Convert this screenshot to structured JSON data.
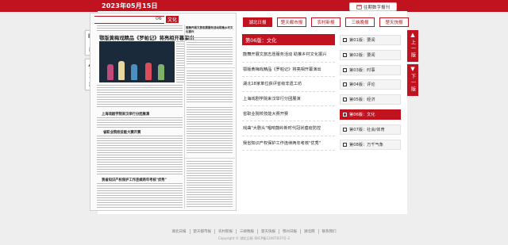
{
  "header": {
    "date": "2023年05月15日",
    "digital_button": "往期数字报刊"
  },
  "colors": {
    "brand_red": "#c1121f",
    "background": "#eeeeee"
  },
  "side_nav": {
    "left": [
      {
        "icon": "calendar-icon",
        "label": "日历"
      },
      {
        "icon": "arrow-up-icon",
        "label": "上一期"
      }
    ],
    "right": [
      {
        "icon": "arrow-up-icon",
        "label": "上一版"
      },
      {
        "icon": "arrow-down-icon",
        "label": "下一版"
      }
    ]
  },
  "newspaper": {
    "page_number": "06",
    "page_name": "文化",
    "headline": "鄂版黄梅戏精品《罗帕记》将亮相开幕演出",
    "headline_2": "上海戏剧学院来汉举行分团展演",
    "headline_3": "省职业院校技能大赛开赛",
    "headline_4": "我省知识产权保护工作连续两年考核\"优秀\"",
    "right_title": "鼓舞开展文旅志愿服务活动助推乡村文化振兴"
  },
  "tabs": [
    {
      "label": "湖北日报",
      "active": true
    },
    {
      "label": "楚天都市报",
      "active": false
    },
    {
      "label": "农村新报",
      "active": false
    },
    {
      "label": "三峡晚报",
      "active": false
    },
    {
      "label": "楚天快报",
      "active": false
    }
  ],
  "section": {
    "title": "第06版：文化"
  },
  "articles": [
    "鼓舞开展文旅志愿服务活动 助推乡村文化振兴",
    "鄂版黄梅戏精品《罗帕记》将亮相开幕演出",
    "湖北18家单位获评省级非遗工坊",
    "上海戏剧学院来汉举行分团展演",
    "省职业院校技能大赛开赛",
    "戏曲\"大剧头\"唱响鼓岭新时代冠状瘟疫防控",
    "我省知识产权保护工作连续两年考核\"优秀\""
  ],
  "pages": [
    {
      "label": "第01版：要闻",
      "active": false
    },
    {
      "label": "第02版：要闻",
      "active": false
    },
    {
      "label": "第03版：时事",
      "active": false
    },
    {
      "label": "第04版：评论",
      "active": false
    },
    {
      "label": "第05版：经济",
      "active": false
    },
    {
      "label": "第06版：文化",
      "active": true
    },
    {
      "label": "第07版：社会/体育",
      "active": false
    },
    {
      "label": "第08版：万千气象",
      "active": false
    }
  ],
  "footer": {
    "links": [
      "湖北日报",
      "楚天都市报",
      "农村新报",
      "三峡晚报",
      "楚天快报",
      "鄂州日报",
      "湖北网",
      "联系我们"
    ],
    "copyright": "Copyright © 湖北日报 鄂ICP备12007837号-2"
  }
}
